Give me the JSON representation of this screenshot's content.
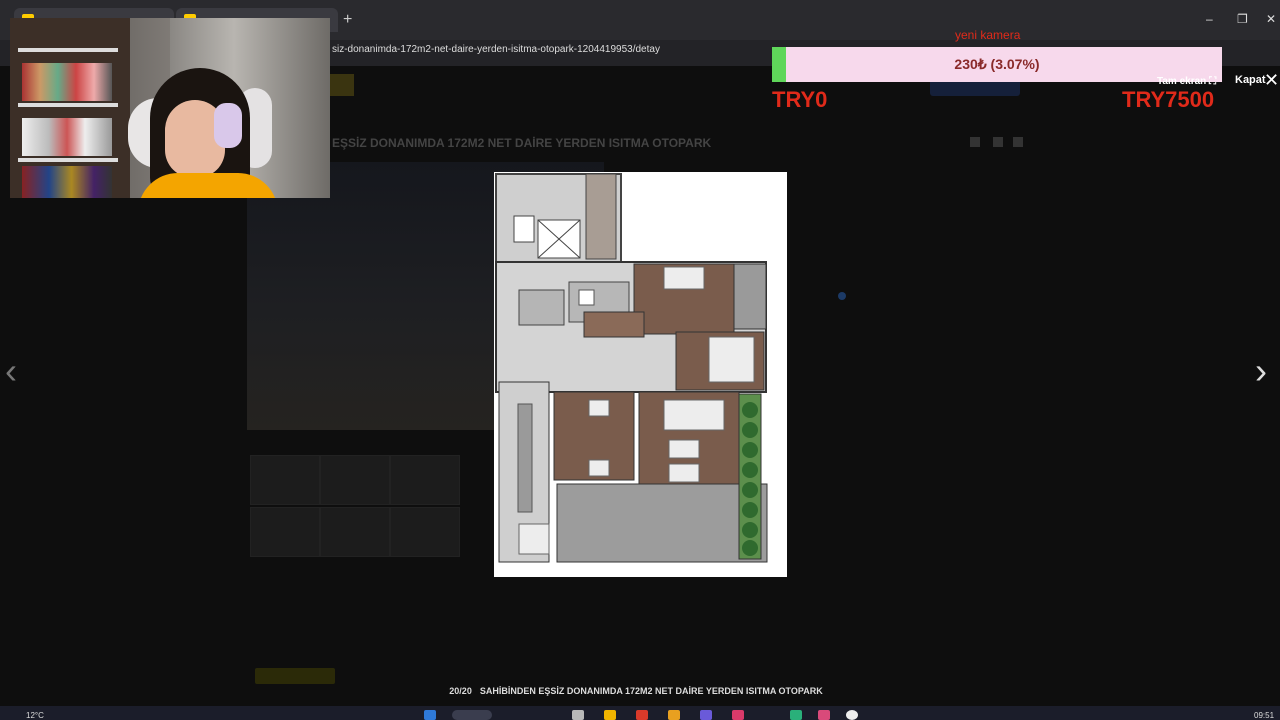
{
  "browser": {
    "url": "siz-donanimda-172m2-net-daire-yerden-isitma-otopark-1204419953/detay",
    "new_tab_label": "+"
  },
  "listing": {
    "title": "EŞSİZ DONANIMDA 172M2 NET DAİRE YERDEN ISITMA OTOPARK"
  },
  "donation": {
    "current_text": "230₺ (3.07%)",
    "progress_pct": 3.07,
    "min_label": "TRY0",
    "max_label": "TRY7500",
    "camera_label": "yeni kamera",
    "bar_color": "#f7d9ec",
    "fill_color": "#5fd65a"
  },
  "viewer": {
    "fullscreen_label": "Tam ekran",
    "close_label": "Kapat",
    "counter": "20/20",
    "caption": "SAHİBİNDEN EŞSİZ DONANIMDA 172M2 NET DAİRE YERDEN ISITMA OTOPARK",
    "prev_icon": "chevron-left-icon",
    "next_icon": "chevron-right-icon",
    "close_icon": "close-icon"
  },
  "taskbar": {
    "weather": "12°C",
    "time": "09:51"
  }
}
